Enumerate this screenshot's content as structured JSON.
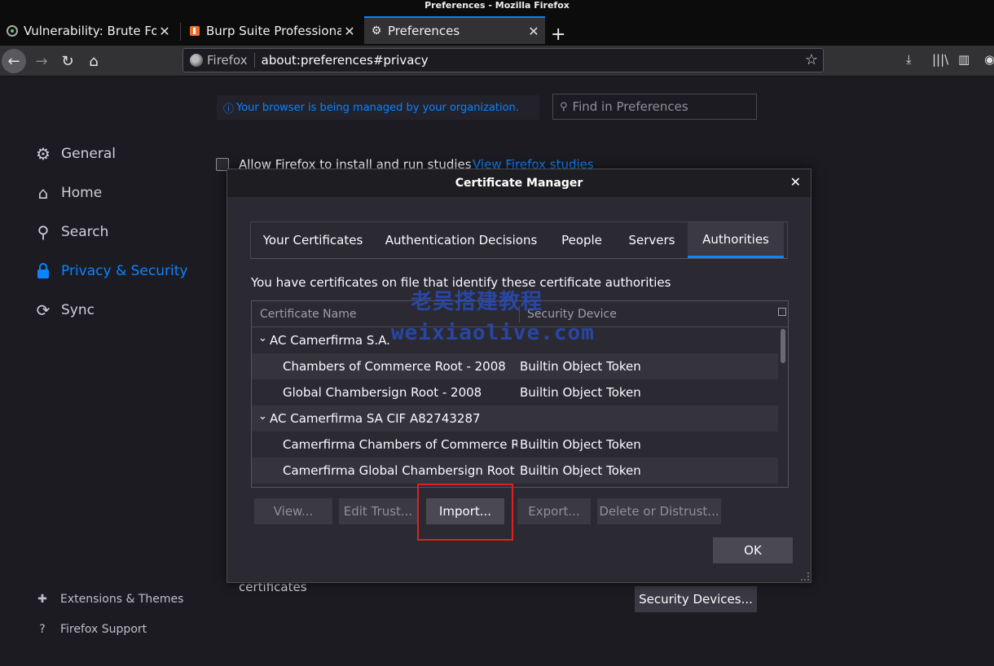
{
  "window": {
    "title": "Preferences - Mozilla Firefox"
  },
  "tabs": [
    {
      "label": "Vulnerability: Brute Force",
      "icon": "dvwa-icon"
    },
    {
      "label": "Burp Suite Professional",
      "icon": "burp-icon"
    },
    {
      "label": "Preferences",
      "icon": "gear-icon"
    }
  ],
  "navbar": {
    "identity": "Firefox",
    "url": "about:preferences#privacy"
  },
  "prefs": {
    "managed_notice": "Your browser is being managed by your organization.",
    "find_placeholder": "Find in Preferences",
    "categories": [
      {
        "label": "General",
        "icon": "gear-icon"
      },
      {
        "label": "Home",
        "icon": "home-icon"
      },
      {
        "label": "Search",
        "icon": "search-icon"
      },
      {
        "label": "Privacy & Security",
        "icon": "lock-icon"
      },
      {
        "label": "Sync",
        "icon": "sync-icon"
      }
    ],
    "footer": [
      {
        "label": "Extensions & Themes",
        "icon": "puzzle-icon"
      },
      {
        "label": "Firefox Support",
        "icon": "help-icon"
      }
    ],
    "studies_label": "Allow Firefox to install and run studies",
    "studies_link": "View Firefox studies",
    "certificates_label": "certificates",
    "security_devices_button": "Security Devices..."
  },
  "dialog": {
    "title": "Certificate Manager",
    "tabs": [
      "Your Certificates",
      "Authentication Decisions",
      "People",
      "Servers",
      "Authorities"
    ],
    "selected_tab": "Authorities",
    "description": "You have certificates on file that identify these certificate authorities",
    "columns": [
      "Certificate Name",
      "Security Device"
    ],
    "rows": [
      {
        "name": "AC Camerfirma S.A.",
        "device": "",
        "group": true
      },
      {
        "name": "Chambers of Commerce Root - 2008",
        "device": "Builtin Object Token",
        "group": false
      },
      {
        "name": "Global Chambersign Root - 2008",
        "device": "Builtin Object Token",
        "group": false
      },
      {
        "name": "AC Camerfirma SA CIF A82743287",
        "device": "",
        "group": true
      },
      {
        "name": "Camerfirma Chambers of Commerce Ro...",
        "device": "Builtin Object Token",
        "group": false
      },
      {
        "name": "Camerfirma Global Chambersign Root",
        "device": "Builtin Object Token",
        "group": false
      }
    ],
    "buttons": {
      "view": "View...",
      "edit_trust": "Edit Trust...",
      "import": "Import...",
      "export": "Export...",
      "delete": "Delete or Distrust...",
      "ok": "OK"
    }
  },
  "watermark": {
    "line1": "老吴搭建教程",
    "line2": "weixiaolive.com"
  }
}
